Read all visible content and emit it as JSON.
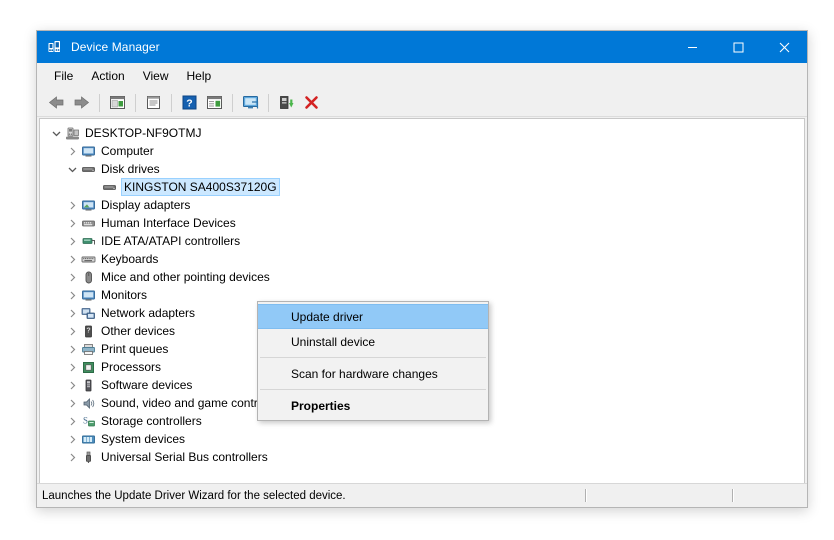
{
  "window": {
    "title": "Device Manager",
    "title_icon": "device-manager-icon",
    "controls": [
      {
        "name": "minimize-button",
        "glyph": "–"
      },
      {
        "name": "maximize-button",
        "glyph": "☐"
      },
      {
        "name": "close-button",
        "glyph": "✕"
      }
    ]
  },
  "menubar": {
    "items": [
      {
        "name": "menu-file",
        "label": "File"
      },
      {
        "name": "menu-action",
        "label": "Action"
      },
      {
        "name": "menu-view",
        "label": "View"
      },
      {
        "name": "menu-help",
        "label": "Help"
      }
    ]
  },
  "toolbar": {
    "items": [
      {
        "name": "back-button",
        "icon": "back-arrow-icon"
      },
      {
        "name": "forward-button",
        "icon": "forward-arrow-icon"
      },
      {
        "name": "separator-1",
        "icon": "separator"
      },
      {
        "name": "show-hide-console-tree-button",
        "icon": "console-tree-icon"
      },
      {
        "name": "separator-2",
        "icon": "separator"
      },
      {
        "name": "properties-button",
        "icon": "properties-icon"
      },
      {
        "name": "separator-3",
        "icon": "separator"
      },
      {
        "name": "help-button",
        "icon": "help-question-icon"
      },
      {
        "name": "view-button",
        "icon": "view-list-icon"
      },
      {
        "name": "separator-4",
        "icon": "separator"
      },
      {
        "name": "scan-for-hardware-changes-button",
        "icon": "monitor-scan-icon"
      },
      {
        "name": "separator-5",
        "icon": "separator"
      },
      {
        "name": "update-driver-button",
        "icon": "update-driver-icon"
      },
      {
        "name": "uninstall-device-button",
        "icon": "red-x-icon"
      }
    ]
  },
  "tree": {
    "nodes": [
      {
        "name": "tree-node-desktop",
        "label": "DESKTOP-NF9OTMJ",
        "level": 0,
        "chevron": "expanded",
        "icon": "computer-root-icon",
        "selected": false
      },
      {
        "name": "tree-node-computer",
        "label": "Computer",
        "level": 1,
        "chevron": "collapsed",
        "icon": "monitor-icon",
        "selected": false
      },
      {
        "name": "tree-node-disk-drives",
        "label": "Disk drives",
        "level": 1,
        "chevron": "expanded",
        "icon": "disk-drive-icon",
        "selected": false
      },
      {
        "name": "tree-node-kingston-ssd",
        "label": "KINGSTON SA400S37120G",
        "level": 2,
        "chevron": "none",
        "icon": "disk-drive-icon",
        "selected": true
      },
      {
        "name": "tree-node-display-adapters",
        "label": "Display adapters",
        "level": 1,
        "chevron": "collapsed",
        "icon": "display-adapter-icon",
        "selected": false
      },
      {
        "name": "tree-node-hid",
        "label": "Human Interface Devices",
        "level": 1,
        "chevron": "collapsed",
        "icon": "hid-icon",
        "selected": false
      },
      {
        "name": "tree-node-ide-ata",
        "label": "IDE ATA/ATAPI controllers",
        "level": 1,
        "chevron": "collapsed",
        "icon": "ide-controller-icon",
        "selected": false
      },
      {
        "name": "tree-node-keyboards",
        "label": "Keyboards",
        "level": 1,
        "chevron": "collapsed",
        "icon": "keyboard-icon",
        "selected": false
      },
      {
        "name": "tree-node-mice",
        "label": "Mice and other pointing devices",
        "level": 1,
        "chevron": "collapsed",
        "icon": "mouse-icon",
        "selected": false
      },
      {
        "name": "tree-node-monitors",
        "label": "Monitors",
        "level": 1,
        "chevron": "collapsed",
        "icon": "monitor-icon",
        "selected": false
      },
      {
        "name": "tree-node-network-adapters",
        "label": "Network adapters",
        "level": 1,
        "chevron": "collapsed",
        "icon": "network-adapter-icon",
        "selected": false
      },
      {
        "name": "tree-node-other-devices",
        "label": "Other devices",
        "level": 1,
        "chevron": "collapsed",
        "icon": "other-device-icon",
        "selected": false
      },
      {
        "name": "tree-node-print-queues",
        "label": "Print queues",
        "level": 1,
        "chevron": "collapsed",
        "icon": "printer-icon",
        "selected": false
      },
      {
        "name": "tree-node-processors",
        "label": "Processors",
        "level": 1,
        "chevron": "collapsed",
        "icon": "processor-icon",
        "selected": false
      },
      {
        "name": "tree-node-software-devices",
        "label": "Software devices",
        "level": 1,
        "chevron": "collapsed",
        "icon": "software-device-icon",
        "selected": false
      },
      {
        "name": "tree-node-sound-video",
        "label": "Sound, video and game controllers",
        "level": 1,
        "chevron": "collapsed",
        "icon": "speaker-icon",
        "selected": false
      },
      {
        "name": "tree-node-storage-controllers",
        "label": "Storage controllers",
        "level": 1,
        "chevron": "collapsed",
        "icon": "storage-controller-icon",
        "selected": false
      },
      {
        "name": "tree-node-system-devices",
        "label": "System devices",
        "level": 1,
        "chevron": "collapsed",
        "icon": "system-device-icon",
        "selected": false
      },
      {
        "name": "tree-node-usb-controllers",
        "label": "Universal Serial Bus controllers",
        "level": 1,
        "chevron": "collapsed",
        "icon": "usb-icon",
        "selected": false
      }
    ]
  },
  "context_menu": {
    "items": [
      {
        "name": "context-menu-update-driver",
        "label": "Update driver",
        "highlight": true,
        "bold": false
      },
      {
        "name": "context-menu-uninstall-device",
        "label": "Uninstall device",
        "highlight": false,
        "bold": false
      },
      {
        "name": "context-menu-separator-1",
        "label": "",
        "separator": true
      },
      {
        "name": "context-menu-scan-hardware",
        "label": "Scan for hardware changes",
        "highlight": false,
        "bold": false
      },
      {
        "name": "context-menu-separator-2",
        "label": "",
        "separator": true
      },
      {
        "name": "context-menu-properties",
        "label": "Properties",
        "highlight": false,
        "bold": true
      }
    ]
  },
  "statusbar": {
    "text": "Launches the Update Driver Wizard for the selected device.",
    "cell_b": "",
    "cell_c": ""
  },
  "colors": {
    "titlebar": "#0078d7",
    "highlight": "#91c9f7",
    "selection": "#cce8ff",
    "chrome": "#f0f0f0",
    "pane": "#ffffff",
    "danger": "#d32222"
  }
}
